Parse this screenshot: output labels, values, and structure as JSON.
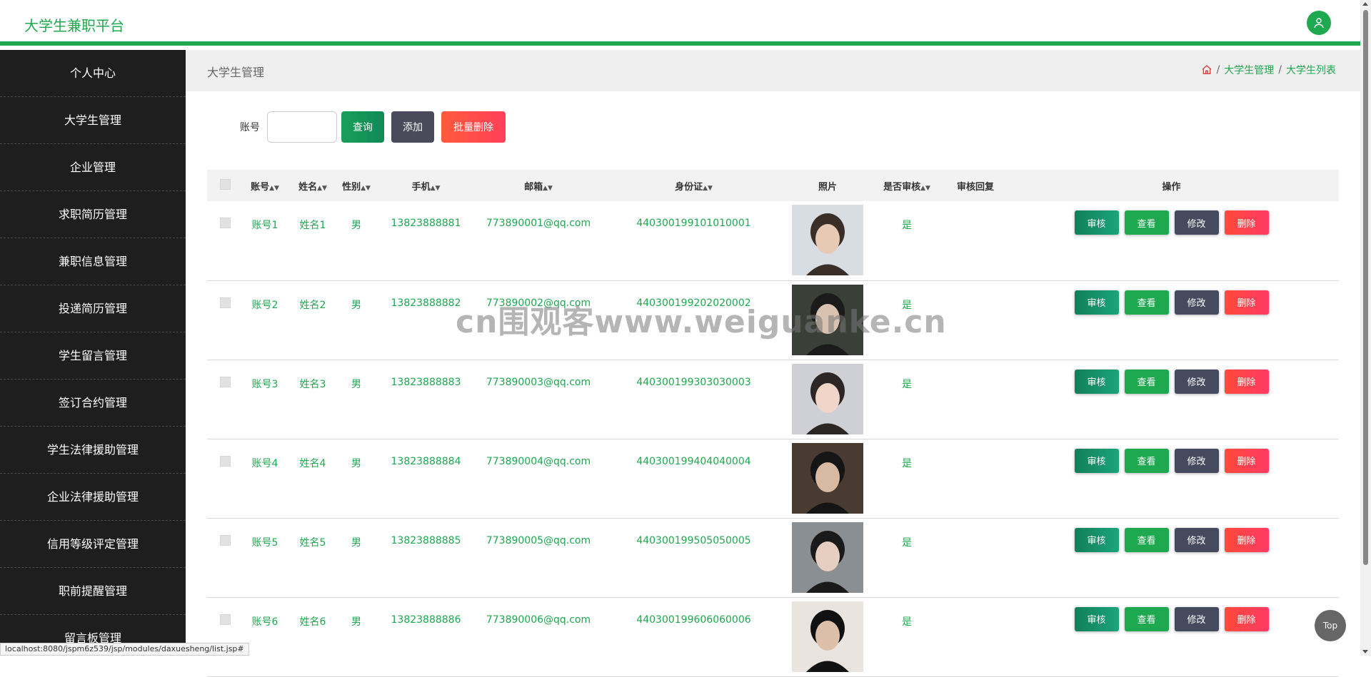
{
  "header": {
    "title": "大学生兼职平台",
    "user_icon": "user-icon",
    "accent": "#1ea84f"
  },
  "sidebar": {
    "items": [
      {
        "label": "个人中心"
      },
      {
        "label": "大学生管理"
      },
      {
        "label": "企业管理"
      },
      {
        "label": "求职简历管理"
      },
      {
        "label": "兼职信息管理"
      },
      {
        "label": "投递简历管理"
      },
      {
        "label": "学生留言管理"
      },
      {
        "label": "签订合约管理"
      },
      {
        "label": "学生法律援助管理"
      },
      {
        "label": "企业法律援助管理"
      },
      {
        "label": "信用等级评定管理"
      },
      {
        "label": "职前提醒管理"
      },
      {
        "label": "留言板管理"
      }
    ]
  },
  "page": {
    "title": "大学生管理"
  },
  "breadcrumb": {
    "home_icon": "home-icon",
    "items": [
      "大学生管理",
      "大学生列表"
    ],
    "separator": "/"
  },
  "search": {
    "label": "账号",
    "value": "",
    "query_label": "查询",
    "add_label": "添加",
    "bulk_delete_label": "批量删除"
  },
  "table": {
    "headers": {
      "account": "账号",
      "name": "姓名",
      "gender": "性别",
      "phone": "手机",
      "email": "邮箱",
      "idcard": "身份证",
      "photo": "照片",
      "audited": "是否审核",
      "reply": "审核回复",
      "ops": "操作"
    },
    "op_labels": {
      "audit": "审核",
      "view": "查看",
      "edit": "修改",
      "delete": "删除"
    },
    "rows": [
      {
        "account": "账号1",
        "name": "姓名1",
        "gender": "男",
        "phone": "13823888881",
        "email": "773890001@qq.com",
        "idcard": "440300199101010001",
        "audited": "是",
        "reply": ""
      },
      {
        "account": "账号2",
        "name": "姓名2",
        "gender": "男",
        "phone": "13823888882",
        "email": "773890002@qq.com",
        "idcard": "440300199202020002",
        "audited": "是",
        "reply": ""
      },
      {
        "account": "账号3",
        "name": "姓名3",
        "gender": "男",
        "phone": "13823888883",
        "email": "773890003@qq.com",
        "idcard": "440300199303030003",
        "audited": "是",
        "reply": ""
      },
      {
        "account": "账号4",
        "name": "姓名4",
        "gender": "男",
        "phone": "13823888884",
        "email": "773890004@qq.com",
        "idcard": "440300199404040004",
        "audited": "是",
        "reply": ""
      },
      {
        "account": "账号5",
        "name": "姓名5",
        "gender": "男",
        "phone": "13823888885",
        "email": "773890005@qq.com",
        "idcard": "440300199505050005",
        "audited": "是",
        "reply": ""
      },
      {
        "account": "账号6",
        "name": "姓名6",
        "gender": "男",
        "phone": "13823888886",
        "email": "773890006@qq.com",
        "idcard": "440300199606060006",
        "audited": "是",
        "reply": ""
      }
    ]
  },
  "watermark": "cn围观客www.weiguanke.cn",
  "back_to_top": "Top",
  "status_url": "localhost:8080/jspm6z539/jsp/modules/daxuesheng/list.jsp#"
}
